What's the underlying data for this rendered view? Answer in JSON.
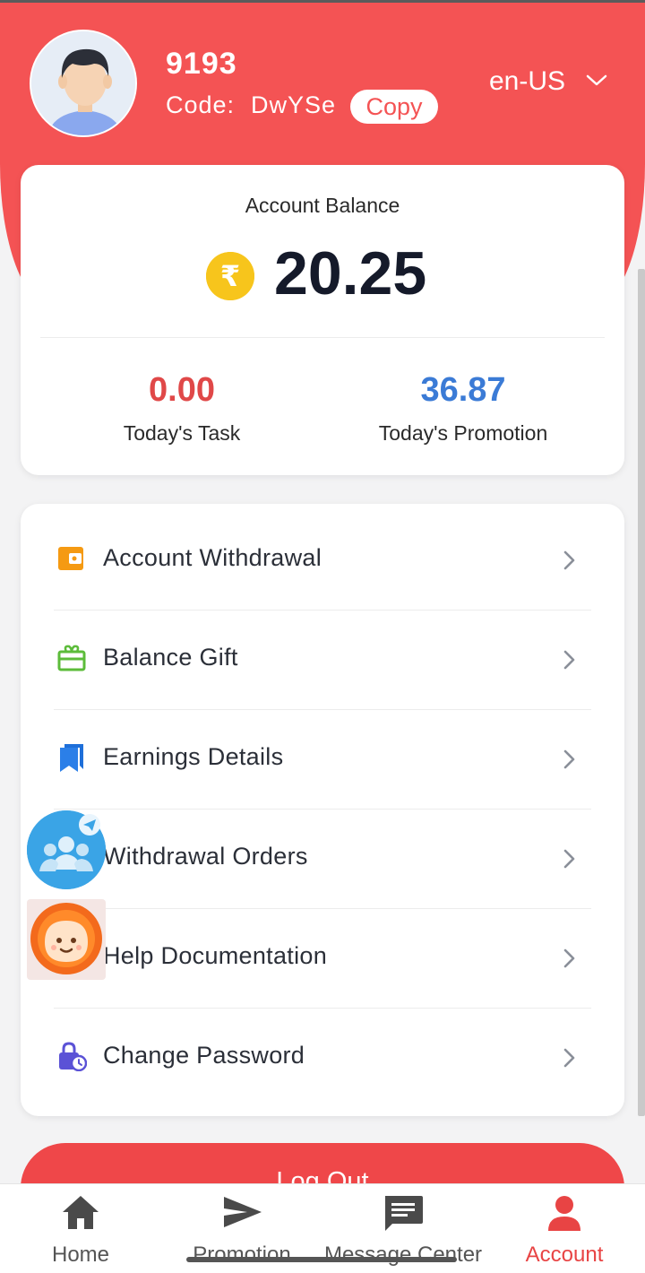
{
  "header": {
    "user_id": "9193",
    "code_label": "Code:",
    "code_value": "DwYSe",
    "copy_label": "Copy",
    "language": "en-US"
  },
  "balance": {
    "title": "Account Balance",
    "currency_symbol": "₹",
    "amount": "20.25",
    "stats": [
      {
        "value": "0.00",
        "label": "Today's Task",
        "color": "#e04848"
      },
      {
        "value": "36.87",
        "label": "Today's Promotion",
        "color": "#3b7bd6"
      }
    ]
  },
  "menu": {
    "items": [
      {
        "label": "Account Withdrawal",
        "icon": "wallet-icon"
      },
      {
        "label": "Balance Gift",
        "icon": "gift-icon"
      },
      {
        "label": "Earnings Details",
        "icon": "bookmark-icon"
      },
      {
        "label": "Withdrawal Orders",
        "icon": "orders-icon"
      },
      {
        "label": "Help Documentation",
        "icon": "help-icon"
      },
      {
        "label": "Change Password",
        "icon": "lock-clock-icon"
      }
    ]
  },
  "logout_label": "Log Out",
  "nav": {
    "items": [
      {
        "label": "Home",
        "icon": "home-icon"
      },
      {
        "label": "Promotion",
        "icon": "send-icon"
      },
      {
        "label": "Message Center",
        "icon": "message-icon"
      },
      {
        "label": "Account",
        "icon": "person-icon"
      }
    ],
    "active_color": "#e84444"
  },
  "colors": {
    "brand": "#f45354",
    "accent_blue": "#3b7bd6"
  }
}
